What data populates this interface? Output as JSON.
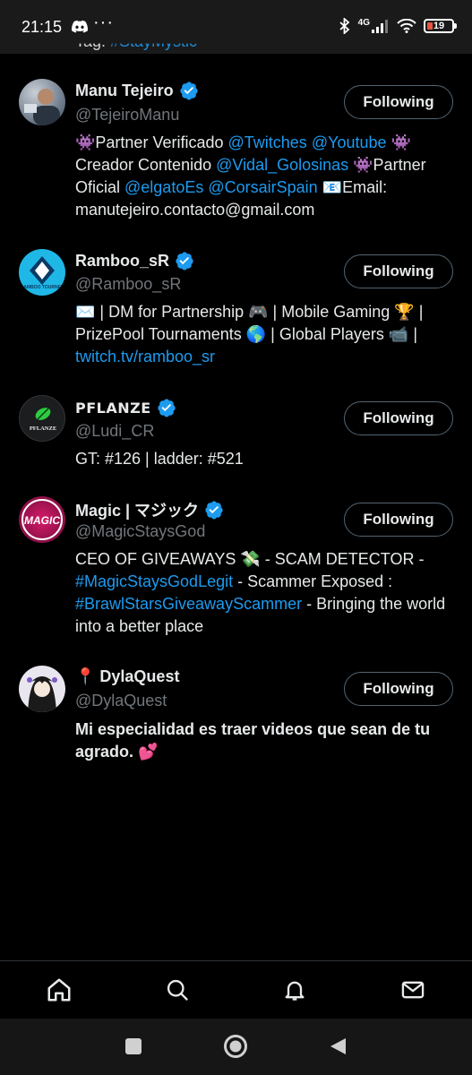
{
  "status_bar": {
    "time": "21:15",
    "dots": "···",
    "network": "4G",
    "battery": "19"
  },
  "partial_top": {
    "label": "Tag: ",
    "link": "#StayMystic"
  },
  "users": [
    {
      "name": "Manu Tejeiro",
      "handle": "@TejeiroManu",
      "button": "Following",
      "bio": [
        {
          "t": "👾Partner Verificado "
        },
        {
          "t": "@Twitches",
          "link": true
        },
        {
          "t": " "
        },
        {
          "t": "@Youtube",
          "link": true
        },
        {
          "t": " 👾 Creador Contenido "
        },
        {
          "t": "@Vidal_Golosinas",
          "link": true
        },
        {
          "t": " 👾Partner Oficial "
        },
        {
          "t": "@elgatoEs",
          "link": true
        },
        {
          "t": " "
        },
        {
          "t": "@CorsairSpain",
          "link": true
        },
        {
          "t": " 📧Email: manutejeiro.contacto@gmail.com"
        }
      ]
    },
    {
      "name": "Ramboo_sR",
      "handle": "@Ramboo_sR",
      "button": "Following",
      "avatar_text": "RAMBOO TOURNEY",
      "bio": [
        {
          "t": "✉️ | DM for Partnership 🎮 | Mobile Gaming 🏆 | PrizePool Tournaments 🌎 | Global Players 📹 | "
        },
        {
          "t": "twitch.tv/ramboo_sr",
          "link": true
        }
      ]
    },
    {
      "name": "PFLANZE",
      "handle": "@Ludi_CR",
      "button": "Following",
      "avatar_text": "PFLANZE",
      "bio": [
        {
          "t": "GT: #126 | ladder: #521"
        }
      ]
    },
    {
      "name": "Magic | マジック",
      "handle": "@MagicStaysGod",
      "button": "Following",
      "avatar_text": "MAGIC",
      "bio": [
        {
          "t": "CEO OF GIVEAWAYS 💸 - SCAM DETECTOR - "
        },
        {
          "t": "#MagicStaysGodLegit",
          "link": true
        },
        {
          "t": " - Scammer Exposed : "
        },
        {
          "t": "#BrawlStarsGiveawayScammer",
          "link": true
        },
        {
          "t": " - Bringing the world into a better place"
        }
      ]
    },
    {
      "name": "📍 DylaQuest",
      "handle": "@DylaQuest",
      "button": "Following",
      "bio": [
        {
          "t": "Mi especialidad es traer videos que sean de tu agrado. 💕"
        }
      ]
    }
  ],
  "colors": {
    "link": "#1d9bf0",
    "verified": "#1d9bf0",
    "muted": "#71767b"
  },
  "nav_icons": [
    "home-icon",
    "search-icon",
    "notifications-icon",
    "messages-icon"
  ]
}
